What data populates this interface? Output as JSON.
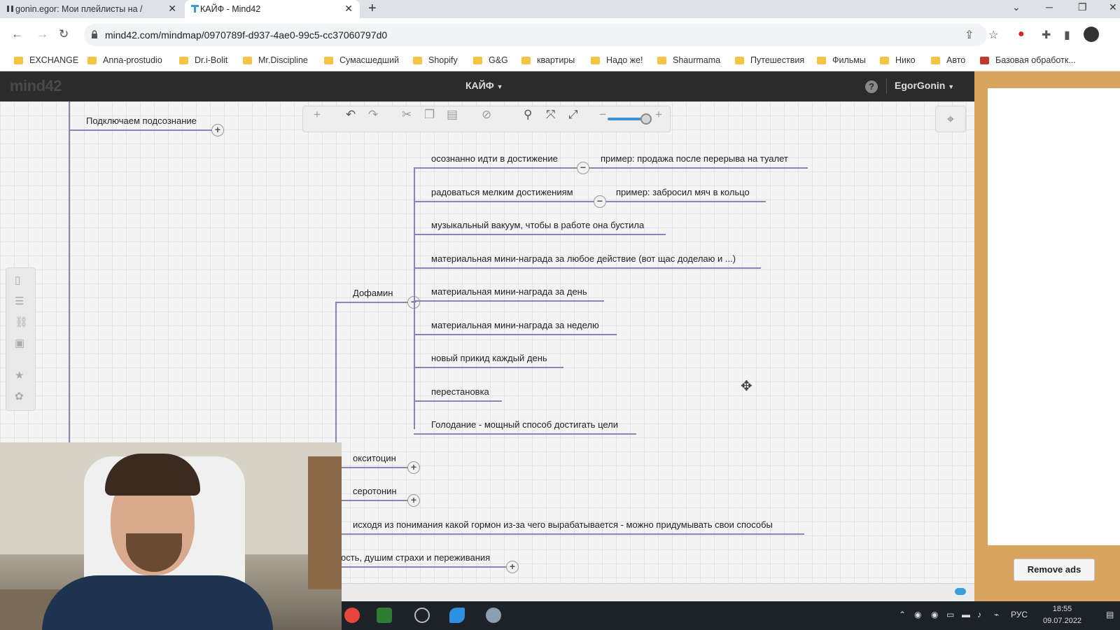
{
  "browser": {
    "tabs": [
      {
        "title": "gonin.egor: Мои плейлисты на /",
        "active": false
      },
      {
        "title": "КАЙФ - Mind42",
        "active": true
      }
    ],
    "url": "mind42.com/mindmap/0970789f-d937-4ae0-99c5-cc37060797d0",
    "bookmarks": [
      "EXCHANGE",
      "Anna-prostudio",
      "Dr.i-Bolit",
      "Mr.Discipline",
      "Сумасшедший",
      "Shopify",
      "G&G",
      "квартиры",
      "Надо же!",
      "Shaurmama",
      "Путешествия",
      "Фильмы",
      "Нико",
      "Авто",
      "Базовая обработк..."
    ]
  },
  "app": {
    "logo": "mind42",
    "doc_title": "КАЙФ",
    "user": "EgorGonin",
    "help": "?"
  },
  "mindmap": {
    "top_node": "Подключаем подсознание",
    "dopamine": "Дофамин",
    "children": [
      {
        "text": "осознанно идти в достижение",
        "note": "пример: продажа после перерыва на туалет"
      },
      {
        "text": "радоваться мелким достижениям",
        "note": "пример: забросил мяч в кольцо"
      },
      {
        "text": "музыкальный вакуум, чтобы в работе она бустила"
      },
      {
        "text": "материальная мини-награда за любое действие (вот щас доделаю и ...)"
      },
      {
        "text": "материальная мини-награда за день"
      },
      {
        "text": "материальная мини-награда за неделю"
      },
      {
        "text": "новый прикид каждый день"
      },
      {
        "text": "перестановка"
      },
      {
        "text": "Голодание - мощный способ достигать цели"
      }
    ],
    "siblings": [
      {
        "text": "окситоцин"
      },
      {
        "text": "серотонин"
      },
      {
        "text": "исходя из понимания какой гормон из-за чего вырабатывается - можно придумывать свои способы"
      },
      {
        "text": "ость, душим страхи и переживания"
      }
    ],
    "toggle_minus": "−",
    "toggle_plus": "+"
  },
  "ad": {
    "remove_label": "Remove ads"
  },
  "taskbar": {
    "lang": "РУС",
    "time": "18:55",
    "date": "09.07.2022"
  },
  "colors": {
    "branch": "#8f82b8",
    "accent": "#3a93d6",
    "ad_bg": "#d9a45f"
  }
}
